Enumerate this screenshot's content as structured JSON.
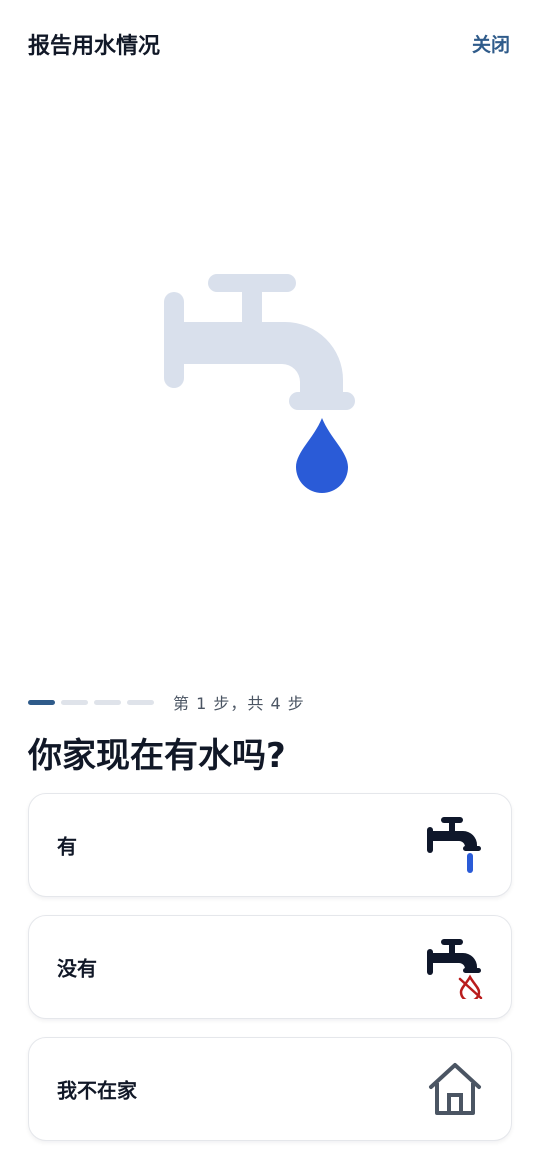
{
  "header": {
    "title": "报告用水情况",
    "close_label": "关闭"
  },
  "progress": {
    "current_step": 1,
    "total_steps": 4,
    "text": "第 1 步，共 4 步"
  },
  "question": "你家现在有水吗?",
  "options": [
    {
      "label": "有",
      "icon": "faucet-running-icon"
    },
    {
      "label": "没有",
      "icon": "faucet-no-water-icon"
    },
    {
      "label": "我不在家",
      "icon": "house-icon"
    }
  ],
  "colors": {
    "accent": "#2f5b8a",
    "drop": "#2a5bd7",
    "faucet_hero": "#d9e0ec",
    "icon_dark": "#0f172a",
    "no_water_red": "#b91c1c",
    "house_gray": "#4b5563"
  }
}
